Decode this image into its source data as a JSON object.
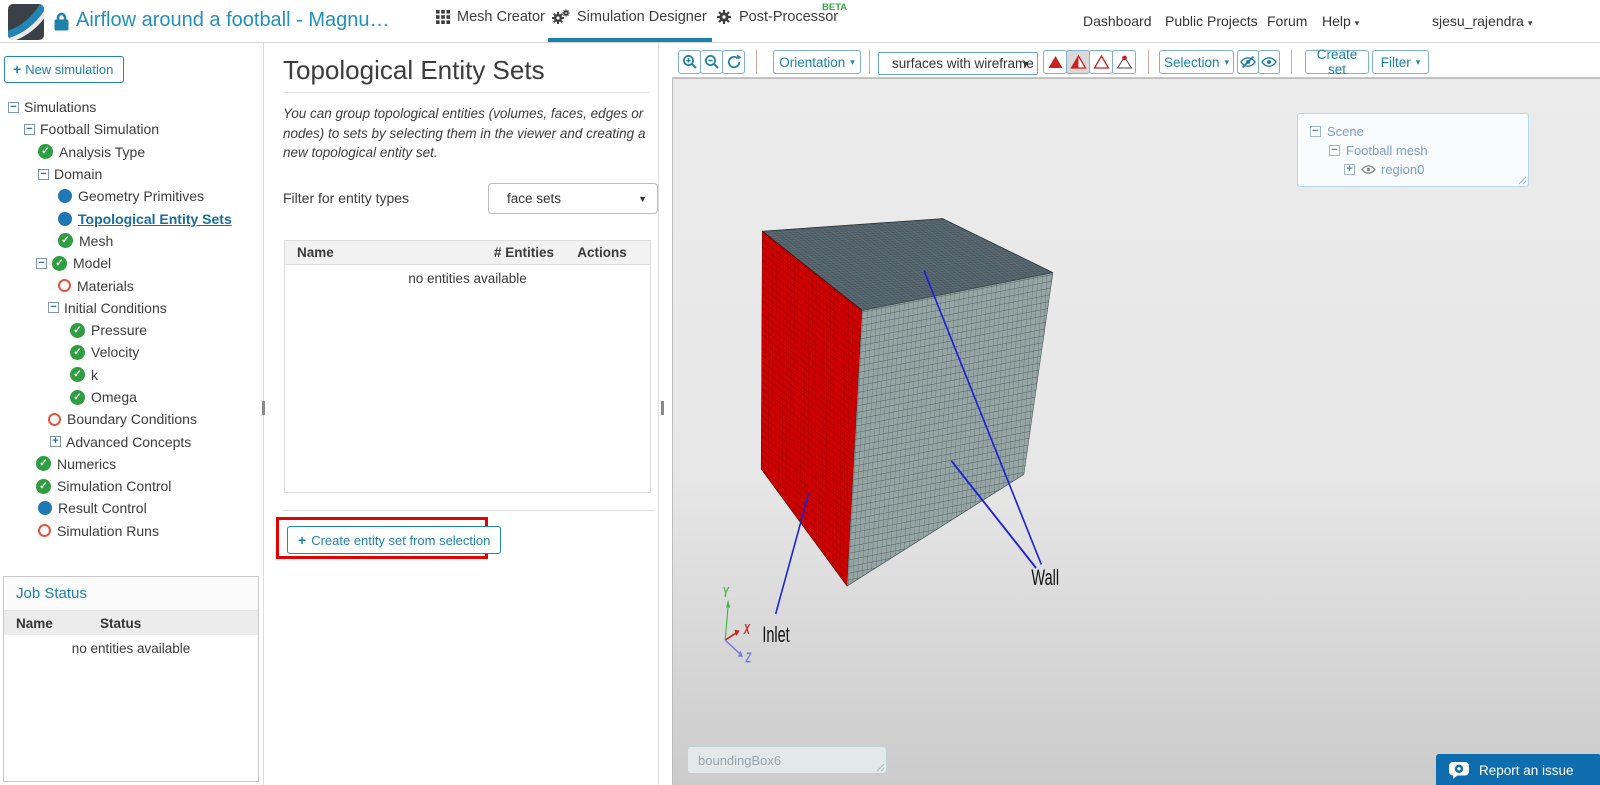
{
  "header": {
    "project_title": "Airflow around a football - Magnu…",
    "tabs": [
      {
        "label": "Mesh Creator"
      },
      {
        "label": "Simulation Designer",
        "active": true
      },
      {
        "label": "Post-Processor",
        "badge": "BETA"
      }
    ],
    "nav_links": [
      "Dashboard",
      "Public Projects",
      "Forum"
    ],
    "help_label": "Help",
    "username": "sjesu_rajendra"
  },
  "sidebar": {
    "new_simulation_label": "New simulation",
    "tree": [
      {
        "label": "Simulations",
        "indent": 8,
        "toggle": "minus"
      },
      {
        "label": "Football Simulation",
        "indent": 24,
        "toggle": "minus"
      },
      {
        "label": "Analysis Type",
        "indent": 38,
        "status": "check"
      },
      {
        "label": "Domain",
        "indent": 38,
        "toggle": "minus"
      },
      {
        "label": "Geometry Primitives",
        "indent": 58,
        "status": "blue"
      },
      {
        "label": "Topological Entity Sets",
        "indent": 58,
        "status": "blue",
        "selected": true
      },
      {
        "label": "Mesh",
        "indent": 58,
        "status": "check"
      },
      {
        "label": "Model",
        "indent": 36,
        "toggle": "minus",
        "status": "check"
      },
      {
        "label": "Materials",
        "indent": 58,
        "status": "orange"
      },
      {
        "label": "Initial Conditions",
        "indent": 48,
        "toggle": "minus"
      },
      {
        "label": "Pressure",
        "indent": 70,
        "status": "check"
      },
      {
        "label": "Velocity",
        "indent": 70,
        "status": "check"
      },
      {
        "label": "k",
        "indent": 70,
        "status": "check"
      },
      {
        "label": "Omega",
        "indent": 70,
        "status": "check"
      },
      {
        "label": "Boundary Conditions",
        "indent": 48,
        "status": "orange"
      },
      {
        "label": "Advanced Concepts",
        "indent": 50,
        "toggle": "plus"
      },
      {
        "label": "Numerics",
        "indent": 36,
        "status": "check"
      },
      {
        "label": "Simulation Control",
        "indent": 36,
        "status": "check"
      },
      {
        "label": "Result Control",
        "indent": 38,
        "status": "blue"
      },
      {
        "label": "Simulation Runs",
        "indent": 38,
        "status": "orange"
      }
    ],
    "job_status": {
      "title": "Job Status",
      "columns": [
        "Name",
        "Status"
      ],
      "empty_text": "no entities available"
    }
  },
  "panel": {
    "title": "Topological Entity Sets",
    "description": "You can group topological entities (volumes, faces, edges or nodes) to sets by selecting them in the viewer and creating a new topological entity set.",
    "filter_label": "Filter for entity types",
    "filter_value": "face sets",
    "table": {
      "columns": [
        "Name",
        "# Entities",
        "Actions"
      ],
      "empty_text": "no entities available"
    },
    "create_button_label": "Create entity set from selection"
  },
  "viewer": {
    "toolbar": {
      "orientation_label": "Orientation",
      "display_mode_value": "surfaces with wireframe",
      "selection_label": "Selection",
      "create_set_label": "Create set",
      "filter_label": "Filter"
    },
    "scene_tree": {
      "root": "Scene",
      "child": "Football mesh",
      "leaf": "region0"
    },
    "annotations": {
      "inlet": "Inlet",
      "wall": "Wall"
    },
    "axes": {
      "x": "X",
      "y": "Y",
      "z": "Z"
    },
    "bounding_box_value": "boundingBox6",
    "report_issue_label": "Report an issue"
  },
  "colors": {
    "accent_blue": "#1d82ab",
    "inlet_red": "#cc0000",
    "mesh_gray": "#93a4a3",
    "mesh_top": "#55646d",
    "annotation_blue": "#2020d6",
    "beta_green": "#3aa648",
    "highlight_red": "#e60000"
  }
}
